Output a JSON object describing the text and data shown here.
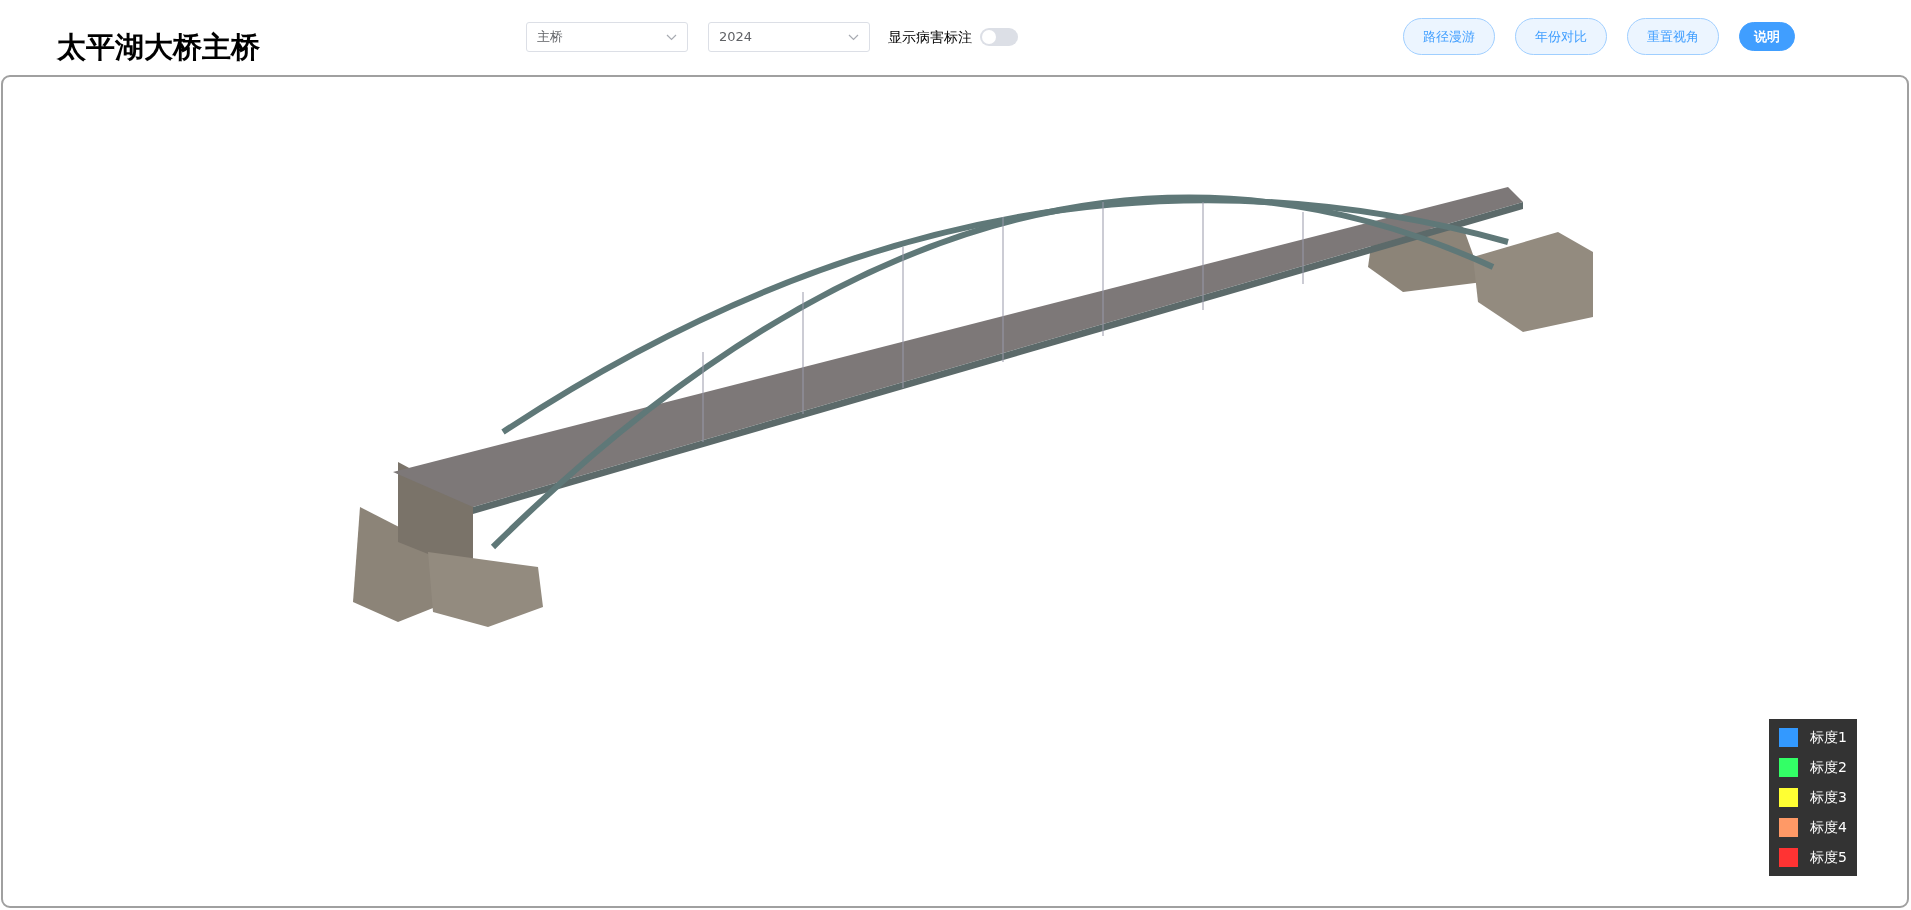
{
  "title": "太平湖大桥主桥",
  "selects": [
    {
      "value": "主桥"
    },
    {
      "value": "2024"
    }
  ],
  "toggle": {
    "label": "显示病害标注",
    "on": false
  },
  "buttons": [
    {
      "label": "路径漫游",
      "kind": "outline"
    },
    {
      "label": "年份对比",
      "kind": "outline"
    },
    {
      "label": "重置视角",
      "kind": "outline"
    },
    {
      "label": "说明",
      "kind": "solid"
    }
  ],
  "legend": [
    {
      "label": "标度1",
      "color": "#3399ff"
    },
    {
      "label": "标度2",
      "color": "#33ff66"
    },
    {
      "label": "标度3",
      "color": "#ffff33"
    },
    {
      "label": "标度4",
      "color": "#ff9966"
    },
    {
      "label": "标度5",
      "color": "#ff3333"
    }
  ]
}
